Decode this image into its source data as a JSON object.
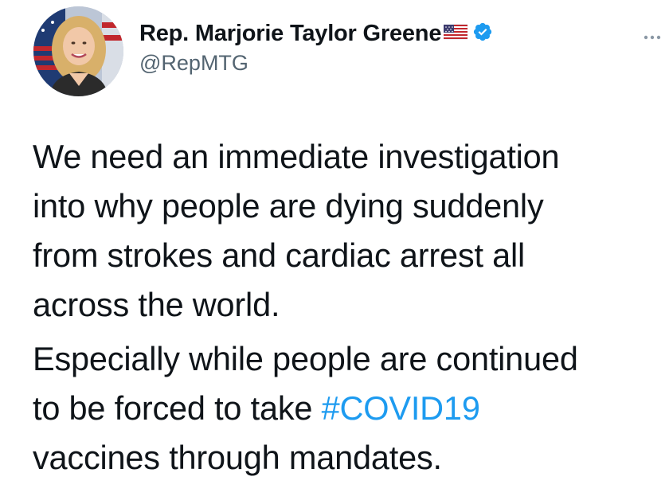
{
  "author": {
    "display_name": "Rep. Marjorie Taylor Greene",
    "handle": "@RepMTG",
    "verified": true,
    "name_emoji": "us-flag-icon"
  },
  "tweet": {
    "paragraphs": [
      {
        "lines": [
          "We need an immediate investigation",
          "into why people are dying suddenly",
          "from strokes and cardiac arrest all",
          "across the world."
        ]
      },
      {
        "lines": [
          "Especially while people are continued",
          "to be forced to take ",
          "vaccines through mandates."
        ],
        "hashtag": "#COVID19"
      }
    ]
  },
  "colors": {
    "text": "#0f1419",
    "secondary_text": "#536471",
    "link": "#1d9bf0",
    "verified_badge": "#1d9bf0"
  },
  "icons": {
    "menu": "more-dots-icon",
    "badge": "verified-badge-icon"
  }
}
